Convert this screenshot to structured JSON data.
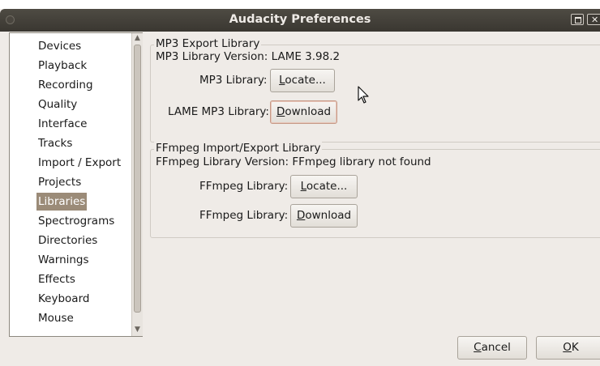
{
  "window": {
    "title": "Audacity Preferences"
  },
  "sidebar": {
    "items": [
      {
        "label": "Devices"
      },
      {
        "label": "Playback"
      },
      {
        "label": "Recording"
      },
      {
        "label": "Quality"
      },
      {
        "label": "Interface"
      },
      {
        "label": "Tracks"
      },
      {
        "label": "Import / Export"
      },
      {
        "label": "Projects"
      },
      {
        "label": "Libraries",
        "selected": true
      },
      {
        "label": "Spectrograms"
      },
      {
        "label": "Directories"
      },
      {
        "label": "Warnings"
      },
      {
        "label": "Effects"
      },
      {
        "label": "Keyboard"
      },
      {
        "label": "Mouse"
      }
    ]
  },
  "mp3": {
    "group_title": "MP3 Export Library",
    "version_text": "MP3 Library Version: LAME 3.98.2",
    "library_label": "MP3 Library:",
    "locate_first": "L",
    "locate_rest": "ocate...",
    "lame_label": "LAME MP3 Library:",
    "download_first": "D",
    "download_rest": "ownload"
  },
  "ffmpeg": {
    "group_title": "FFmpeg Import/Export Library",
    "version_text": "FFmpeg Library Version: FFmpeg library not found",
    "library_label": "FFmpeg Library:",
    "locate_first": "L",
    "locate_rest": "ocate...",
    "library_label_2": "FFmpeg Library:",
    "download_first": "D",
    "download_rest": "ownload"
  },
  "footer": {
    "cancel_first": "C",
    "cancel_rest": "ancel",
    "ok_first": "O",
    "ok_rest": "K"
  },
  "icons": {
    "window_menu": "circle-icon",
    "maximize": "maximize-icon",
    "close": "close-icon",
    "scroll_up": "chevron-up-icon",
    "scroll_down": "chevron-down-icon",
    "pointer": "mouse-pointer-icon"
  },
  "colors": {
    "titlebar": "#3f3c35",
    "window_bg": "#efebe7",
    "selection": "#9b8b78"
  }
}
